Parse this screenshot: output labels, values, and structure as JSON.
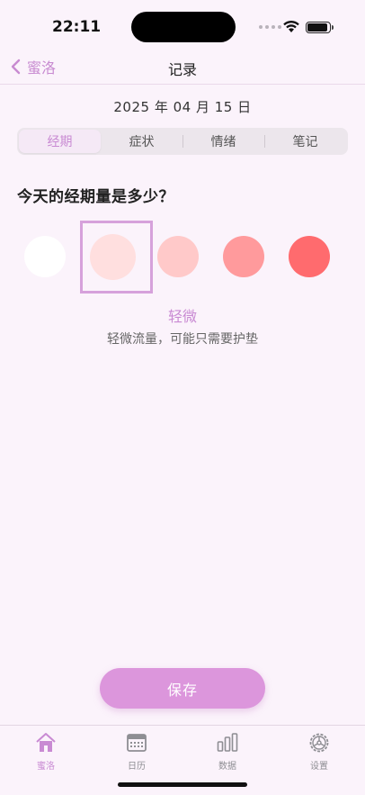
{
  "status_bar": {
    "time": "22:11"
  },
  "nav": {
    "back_label": "蜜洛",
    "title": "记录"
  },
  "date": "2025 年 04 月 15 日",
  "segments": [
    {
      "label": "经期",
      "selected": true
    },
    {
      "label": "症状",
      "selected": false
    },
    {
      "label": "情绪",
      "selected": false
    },
    {
      "label": "笔记",
      "selected": false
    }
  ],
  "question": "今天的经期量是多少？",
  "flow_options": [
    {
      "color": "#ffffff",
      "selected": false
    },
    {
      "color": "#ffdfdf",
      "selected": true
    },
    {
      "color": "#ffc9c9",
      "selected": false
    },
    {
      "color": "#ff9a9c",
      "selected": false
    },
    {
      "color": "#ff6b6e",
      "selected": false
    }
  ],
  "selected_level": {
    "label": "轻微",
    "description": "轻微流量，可能只需要护垫"
  },
  "save_label": "保存",
  "tabbar": [
    {
      "label": "蜜洛",
      "icon": "home-icon",
      "active": true
    },
    {
      "label": "日历",
      "icon": "calendar-icon",
      "active": false
    },
    {
      "label": "数据",
      "icon": "bar-chart-icon",
      "active": false
    },
    {
      "label": "设置",
      "icon": "gear-icon",
      "active": false
    }
  ],
  "colors": {
    "accent": "#c98ad3",
    "button": "#dc96dc",
    "background": "#fbf3fb"
  }
}
